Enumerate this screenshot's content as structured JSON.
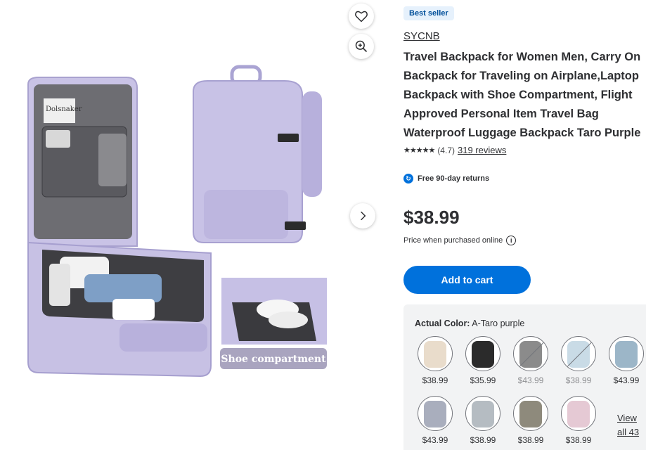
{
  "product": {
    "badge": "Best seller",
    "brand": "SYCNB",
    "title": "Travel Backpack for Women Men, Carry On Backpack for Traveling on Airplane,Laptop Backpack with Shoe Compartment, Flight Approved Personal Item Travel Bag Waterproof Luggage Backpack Taro Purple",
    "rating_stars": "★★★★★",
    "rating_value": "(4.7)",
    "reviews_link": "319 reviews",
    "returns": "Free 90-day returns",
    "price": "$38.99",
    "price_note": "Price when purchased online",
    "add_to_cart": "Add to cart"
  },
  "image": {
    "caption": "Shoe compartment",
    "paper_text": "Dolsnaker"
  },
  "variants": {
    "label_key": "Actual Color:",
    "label_value": "A-Taro purple",
    "view_all_line1": "View",
    "view_all_line2": "all 43",
    "swatches": [
      {
        "price": "$38.99",
        "color": "#e9dccb",
        "available": true
      },
      {
        "price": "$35.99",
        "color": "#2b2b2b",
        "available": true
      },
      {
        "price": "$43.99",
        "color": "#8b8b8b",
        "available": false
      },
      {
        "price": "$38.99",
        "color": "#c9dbe6",
        "available": false
      },
      {
        "price": "$43.99",
        "color": "#9cb6c8",
        "available": true
      },
      {
        "price": "$43.99",
        "color": "#a9aebd",
        "available": true
      },
      {
        "price": "$38.99",
        "color": "#b5bcc2",
        "available": true
      },
      {
        "price": "$38.99",
        "color": "#8e8a7c",
        "available": true
      },
      {
        "price": "$38.99",
        "color": "#e5c9d4",
        "available": true
      }
    ]
  },
  "colors": {
    "accent": "#0071dc",
    "bag_purple": "#c3bde0"
  }
}
